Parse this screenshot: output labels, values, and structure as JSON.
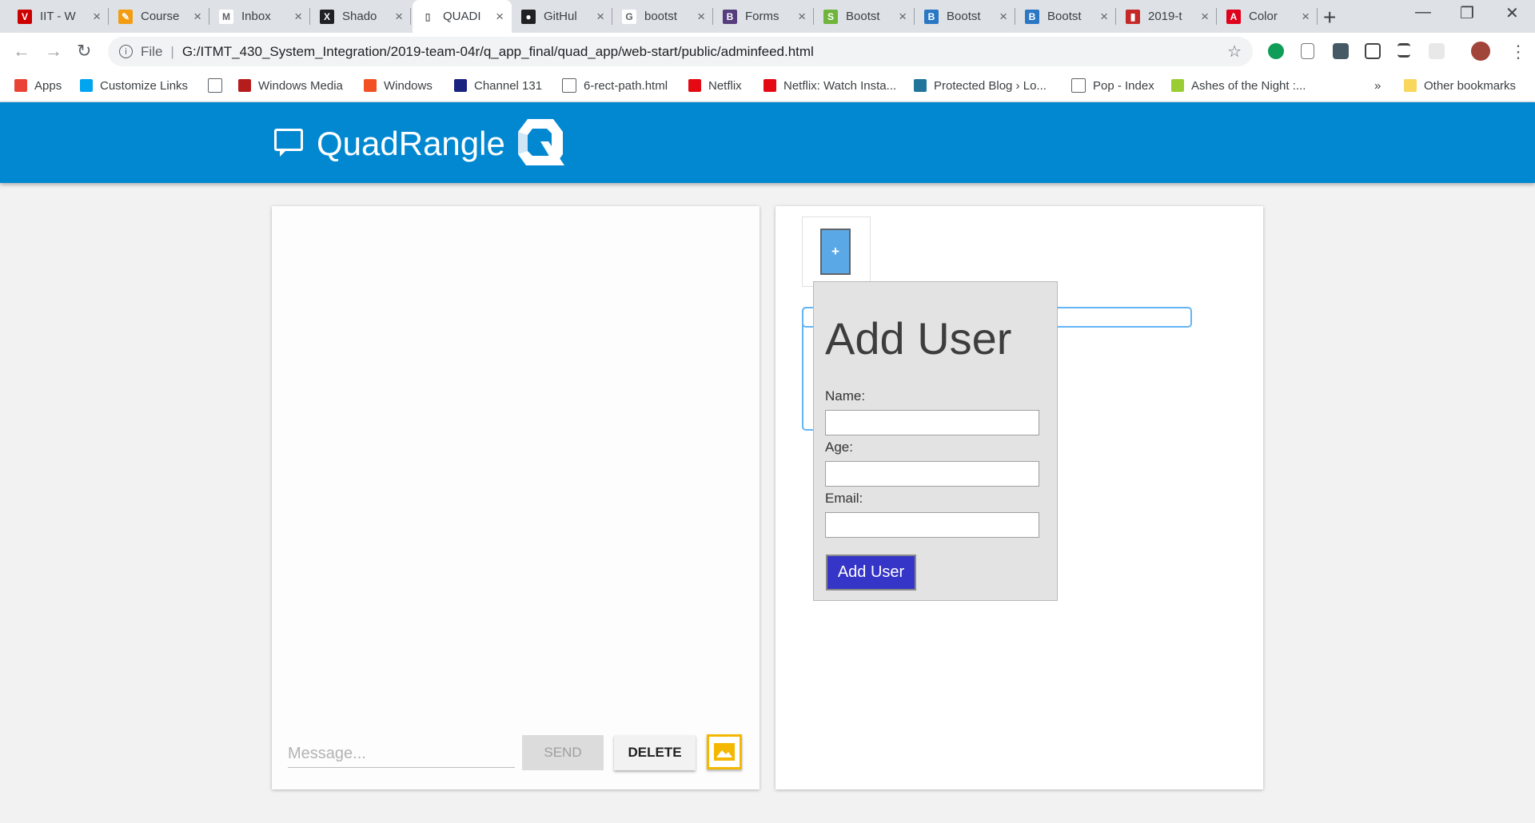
{
  "browser": {
    "tabs": [
      {
        "title": "IIT - W",
        "icon": "iit-icon",
        "color": "#cc0000",
        "glyph": "V"
      },
      {
        "title": "Course",
        "icon": "pencil-icon",
        "color": "#f39c12",
        "glyph": "✎"
      },
      {
        "title": "Inbox",
        "icon": "gmail-icon",
        "color": "#ffffff",
        "glyph": "M"
      },
      {
        "title": "Shado",
        "icon": "x-logo-icon",
        "color": "#202124",
        "glyph": "X"
      },
      {
        "title": "QUADI",
        "icon": "page-icon",
        "color": "#ffffff",
        "glyph": "▯",
        "active": true
      },
      {
        "title": "GitHul",
        "icon": "github-icon",
        "color": "#202124",
        "glyph": "●"
      },
      {
        "title": "bootst",
        "icon": "google-icon",
        "color": "#ffffff",
        "glyph": "G"
      },
      {
        "title": "Forms",
        "icon": "bootstrap-icon",
        "color": "#563d7c",
        "glyph": "B"
      },
      {
        "title": "Bootst",
        "icon": "bootsnipp-icon",
        "color": "#6fb53c",
        "glyph": "S"
      },
      {
        "title": "Bootst",
        "icon": "bootstrap-vue-icon",
        "color": "#2a77c4",
        "glyph": "B"
      },
      {
        "title": "Bootst",
        "icon": "bootstrap-vue-icon",
        "color": "#2a77c4",
        "glyph": "B"
      },
      {
        "title": "2019-t",
        "icon": "document-icon",
        "color": "#c62828",
        "glyph": "▮"
      },
      {
        "title": "Color",
        "icon": "adobe-icon",
        "color": "#e0001b",
        "glyph": "A"
      }
    ],
    "address": {
      "scheme_label": "File",
      "url": "G:/ITMT_430_System_Integration/2019-team-04r/q_app_final/quad_app/web-start/public/adminfeed.html"
    },
    "bookmarks": [
      {
        "label": "Apps",
        "icon": "apps-grid-icon",
        "color": "#ea4335"
      },
      {
        "label": "Customize Links",
        "icon": "windows-icon",
        "color": "#00a4ef"
      },
      {
        "label": "",
        "icon": "page-icon",
        "color": "#ffffff"
      },
      {
        "label": "Windows Media",
        "icon": "media-icon",
        "color": "#b71c1c"
      },
      {
        "label": "Windows",
        "icon": "windows-logo-icon",
        "color": "#f25022"
      },
      {
        "label": "Channel 131",
        "icon": "channel-icon",
        "color": "#1a237e"
      },
      {
        "label": "6-rect-path.html",
        "icon": "page-icon",
        "color": "#ffffff"
      },
      {
        "label": "Netflix",
        "icon": "netflix-icon",
        "color": "#e50914"
      },
      {
        "label": "Netflix: Watch Insta...",
        "icon": "netflix-icon",
        "color": "#e50914"
      },
      {
        "label": "Protected Blog › Lo...",
        "icon": "wordpress-icon",
        "color": "#21759b"
      },
      {
        "label": "Pop - Index",
        "icon": "page-icon",
        "color": "#ffffff"
      },
      {
        "label": "Ashes of the Night :...",
        "icon": "leaf-icon",
        "color": "#9acd32"
      }
    ],
    "overflow_label": "»",
    "other_bookmarks": "Other bookmarks"
  },
  "app": {
    "brand": "QuadRangle",
    "colors": {
      "primary": "#0288d1",
      "accent": "#3535c8",
      "image_button": "#f5b800"
    },
    "chat": {
      "message_placeholder": "Message...",
      "send_label": "SEND",
      "delete_label": "DELETE"
    },
    "admin": {
      "plus_label": "+",
      "popup": {
        "title": "Add User",
        "name_label": "Name:",
        "age_label": "Age:",
        "email_label": "Email:",
        "submit_label": "Add User"
      }
    }
  }
}
